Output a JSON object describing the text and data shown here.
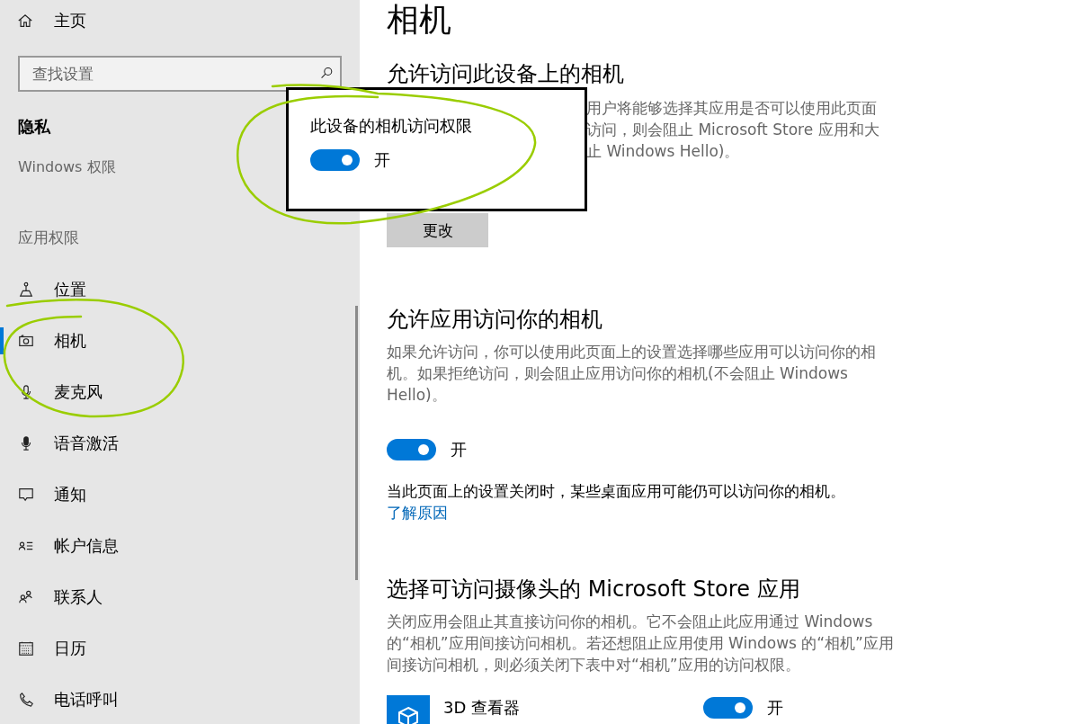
{
  "sidebar": {
    "home": "主页",
    "search": {
      "placeholder": "查找设置"
    },
    "section_title": "隐私",
    "group_1": "Windows 权限",
    "group_2": "应用权限",
    "items": [
      {
        "label": "位置",
        "selected": false
      },
      {
        "label": "相机",
        "selected": true
      },
      {
        "label": "麦克风",
        "selected": false
      },
      {
        "label": "语音激活",
        "selected": false
      },
      {
        "label": "通知",
        "selected": false
      },
      {
        "label": "帐户信息",
        "selected": false
      },
      {
        "label": "联系人",
        "selected": false
      },
      {
        "label": "日历",
        "selected": false
      },
      {
        "label": "电话呼叫",
        "selected": false
      }
    ]
  },
  "main": {
    "title": "相机",
    "sections": [
      {
        "heading": "允许访问此设备上的相机",
        "paragraph_lines": [
          "用户将能够选择其应用是否可以使用此页面",
          "访问，则会阻止 Microsoft Store 应用和大",
          "止 Windows Hello)。"
        ],
        "button": "更改"
      },
      {
        "heading": "允许应用访问你的相机",
        "paragraph": "如果允许访问，你可以使用此页面上的设置选择哪些应用可以访问你的相机。如果拒绝访问，则会阻止应用访问你的相机(不会阻止 Windows Hello)。",
        "toggle": {
          "on": true,
          "label": "开"
        },
        "note": "当此页面上的设置关闭时，某些桌面应用可能仍可以访问你的相机。",
        "link": "了解原因"
      },
      {
        "heading": "选择可访问摄像头的 Microsoft Store 应用",
        "paragraph": "关闭应用会阻止其直接访问你的相机。它不会阻止此应用通过 Windows 的“相机”应用间接访问相机。若还想阻止应用使用 Windows 的“相机”应用间接访问相机，则必须关闭下表中对“相机”应用的访问权限。",
        "apps": [
          {
            "name": "3D 查看器",
            "on": true,
            "label": "开"
          }
        ]
      }
    ]
  },
  "popup": {
    "title": "此设备的相机访问权限",
    "toggle": {
      "on": true,
      "label": "开"
    }
  }
}
